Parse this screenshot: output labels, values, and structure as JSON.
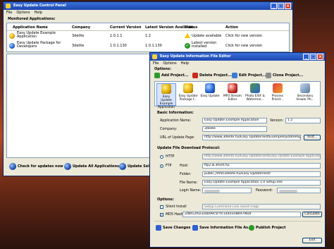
{
  "control_panel": {
    "title": "Easy Update Control Panel",
    "menu": [
      "File",
      "Options",
      "Help"
    ],
    "section": "Monitored Applications:",
    "columns": [
      "Application Name",
      "Company",
      "Current Version",
      "Latest Version Available",
      "Status",
      "Action"
    ],
    "rows": [
      {
        "name": "Easy Update Example Application",
        "company": "3delite",
        "current": "1.0.1.1",
        "latest": "1.2",
        "status": "Update available",
        "action": "Click for new version",
        "icon": "warning-icon"
      },
      {
        "name": "Easy Update Package for Developers",
        "company": "3delite",
        "current": "1.0.1.130",
        "latest": "1.0.1.130",
        "status": "Latest version installed",
        "action": "Click for new version",
        "icon": "check-icon"
      }
    ],
    "footer": {
      "check": "Check for updates now",
      "update_all": "Update All Applications",
      "update_selected": "Update Selected"
    }
  },
  "editor": {
    "title": "Easy Update Information File Editor",
    "menu": [
      "File",
      "Options",
      "Help"
    ],
    "options_label": "Options:",
    "toolbar": {
      "add": "Add Project...",
      "delete": "Delete Project...",
      "edit": "Edit Project...",
      "clone": "Clone Project..."
    },
    "projects": [
      "Easy Update Example Application",
      "Easy Update Package f...",
      "Easy Update",
      "MP3 Stream Editor",
      "Photo EXIF & Watermar...",
      "Process Priorit...",
      "Secondary Viewer Ph..."
    ],
    "basic": {
      "header": "Basic Information:",
      "app_name_label": "Application Name:",
      "app_name": "Easy Update Example Application",
      "version_label": "Version:",
      "version": "1.2",
      "company_label": "Company:",
      "company": "3delite",
      "url_label": "URL of Update Page:",
      "url": "http://www.3delite.hu/Easy Update/Test/ExampleUpdatePage.html",
      "visit": "Visit..."
    },
    "download": {
      "header": "Update File Download Protocol:",
      "http_label": "HTTP",
      "http_value": "http://www.3delite.hu/Easy Update/Test/Easy Update Example Application 1.0 Setup.exe",
      "ftp_label": "FTP",
      "host_label": "Host:",
      "host": "ftp2.w.3host.hu",
      "folder_label": "Folder:",
      "folder": "public_html/3delite.hu/Easy Update/Test/",
      "file_label": "File Name:",
      "file": "Easy Update Example Application 1.0 Setup.exe",
      "login_label": "Login Name:",
      "password_label": "Password:"
    },
    "options": {
      "header": "Options:",
      "silent_label": "Silent Install",
      "silent_placeholder": "Setup Command Line Silent Flags",
      "md5_label": "MD5 Hash",
      "md5": "2dbf12f023c6b99c5f7fc1440358b979baf",
      "calculate": "Calculate"
    },
    "footer": {
      "save": "Save Changes",
      "save_info": "Save Information File As...",
      "publish": "Publish Project",
      "exit": "Exit"
    }
  }
}
